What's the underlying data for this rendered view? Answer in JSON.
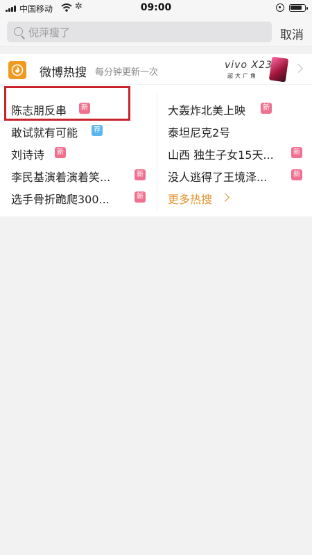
{
  "status_bar": {
    "carrier": "中国移动",
    "time": "09:00"
  },
  "search": {
    "query": "倪萍瘦了",
    "cancel_label": "取消"
  },
  "hot_search": {
    "title": "微博热搜",
    "subtitle": "每分钟更新一次",
    "ad": {
      "brand": "vivo X23",
      "tagline": "超大广角"
    },
    "left_items": [
      {
        "text": "陈志朋反串",
        "badge": "新",
        "badge_type": "new"
      },
      {
        "text": "敢试就有可能",
        "badge": "荐",
        "badge_type": "recommend"
      },
      {
        "text": "刘诗诗",
        "badge": "新",
        "badge_type": "new"
      },
      {
        "text": "李民基演着演着笑...",
        "badge": "新",
        "badge_type": "new"
      },
      {
        "text": "选手骨折跪爬300...",
        "badge": "新",
        "badge_type": "new"
      }
    ],
    "right_items": [
      {
        "text": "大轰炸北美上映",
        "badge": "新",
        "badge_type": "new"
      },
      {
        "text": "泰坦尼克2号",
        "badge": "",
        "badge_type": ""
      },
      {
        "text": "山西 独生子女15天...",
        "badge": "新",
        "badge_type": "new"
      },
      {
        "text": "没人逃得了王境泽...",
        "badge": "新",
        "badge_type": "new"
      }
    ],
    "more_label": "更多热搜"
  },
  "colors": {
    "badge_new": "#f0718f",
    "badge_recommend": "#5ab6ef",
    "accent_orange": "#e3912b",
    "highlight_red": "#c9242b"
  }
}
